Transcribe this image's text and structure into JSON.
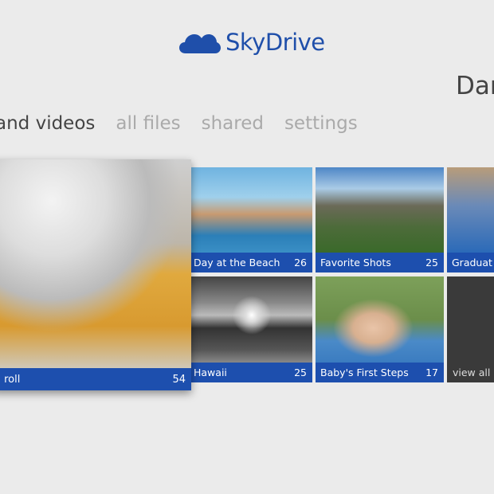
{
  "app": {
    "title": "SkyDrive",
    "logo_icon": "cloud-icon",
    "brand_color": "#1f4faa"
  },
  "user": {
    "name": "Dar"
  },
  "nav": {
    "active": "and videos",
    "tabs": [
      "all files",
      "shared",
      "settings"
    ]
  },
  "albums": [
    {
      "name": "a roll",
      "count": "54"
    },
    {
      "name": "Day at the Beach",
      "count": "26"
    },
    {
      "name": "Favorite Shots",
      "count": "25"
    },
    {
      "name": "Graduat",
      "count": ""
    },
    {
      "name": "Hawaii",
      "count": "25"
    },
    {
      "name": "Baby's First Steps",
      "count": "17"
    }
  ],
  "view_all": "view all",
  "caption_color": "#1d4fae"
}
